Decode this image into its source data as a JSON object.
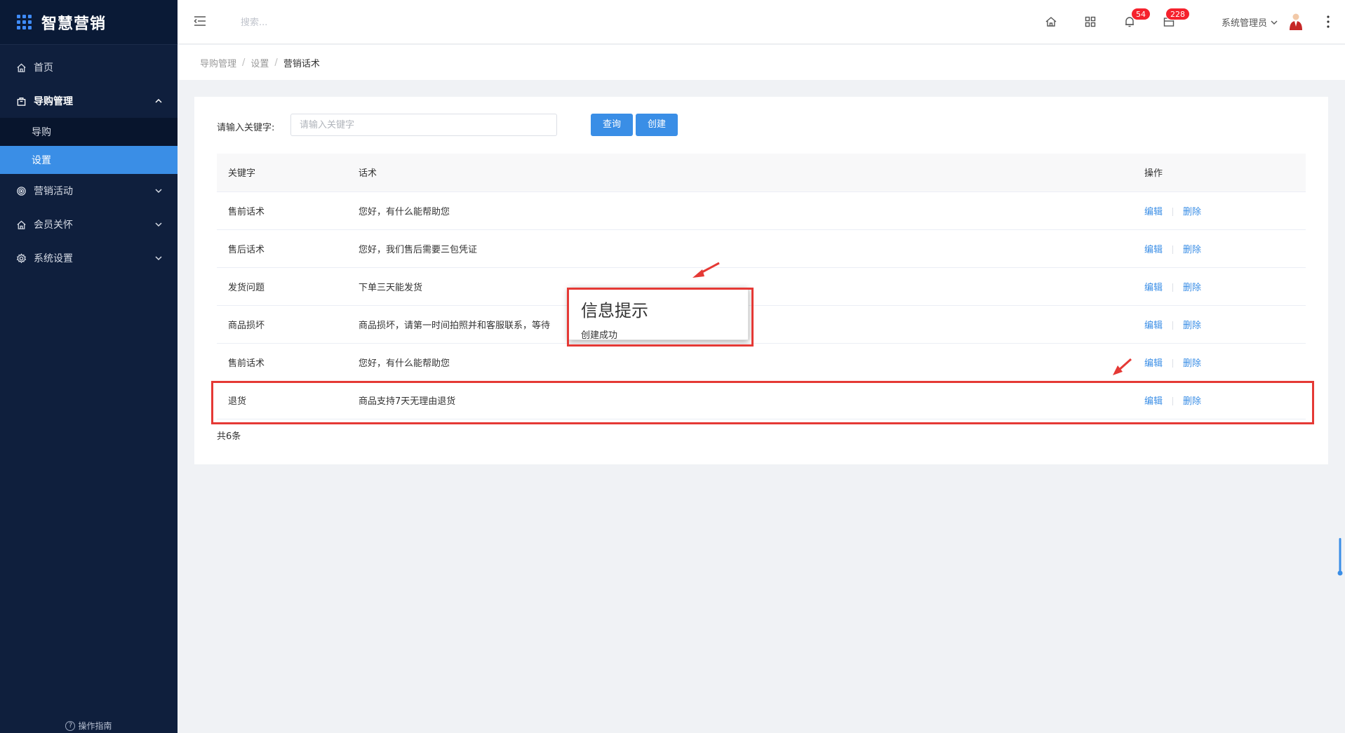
{
  "sidebar": {
    "logo_text": "智慧营销",
    "items": [
      {
        "label": "首页",
        "icon": "home-icon"
      },
      {
        "label": "导购管理",
        "icon": "bag-icon",
        "children": [
          {
            "label": "导购"
          },
          {
            "label": "设置",
            "active": true
          }
        ]
      },
      {
        "label": "营销活动",
        "icon": "target-icon"
      },
      {
        "label": "会员关怀",
        "icon": "home-icon"
      },
      {
        "label": "系统设置",
        "icon": "gear-icon"
      }
    ],
    "guide_label": "操作指南"
  },
  "header": {
    "search_placeholder": "搜索...",
    "notify_badge": "54",
    "message_badge": "228",
    "user_name": "系统管理员"
  },
  "breadcrumb": {
    "items": [
      "导购管理",
      "设置"
    ],
    "current": "营销话术"
  },
  "filter": {
    "label": "请输入关键字:",
    "placeholder": "请输入关键字",
    "query_button": "查询",
    "create_button": "创建"
  },
  "table": {
    "headers": {
      "keyword": "关键字",
      "script": "话术",
      "ops": "操作"
    },
    "rows": [
      {
        "keyword": "售前话术",
        "script": "您好，有什么能帮助您"
      },
      {
        "keyword": "售后话术",
        "script": "您好，我们售后需要三包凭证"
      },
      {
        "keyword": "发货问题",
        "script": "下单三天能发货"
      },
      {
        "keyword": "商品损坏",
        "script": "商品损坏，请第一时间拍照并和客服联系，等待"
      },
      {
        "keyword": "售前话术",
        "script": "您好，有什么能帮助您"
      },
      {
        "keyword": "退货",
        "script": "商品支持7天无理由退货"
      }
    ],
    "edit_label": "编辑",
    "delete_label": "删除",
    "total": "共6条"
  },
  "toast": {
    "title": "信息提示",
    "message": "创建成功"
  },
  "colors": {
    "sidebar_bg": "#0f1f3d",
    "accent": "#3a8ee6",
    "badge": "#f5222d",
    "annotation": "#e53935"
  }
}
